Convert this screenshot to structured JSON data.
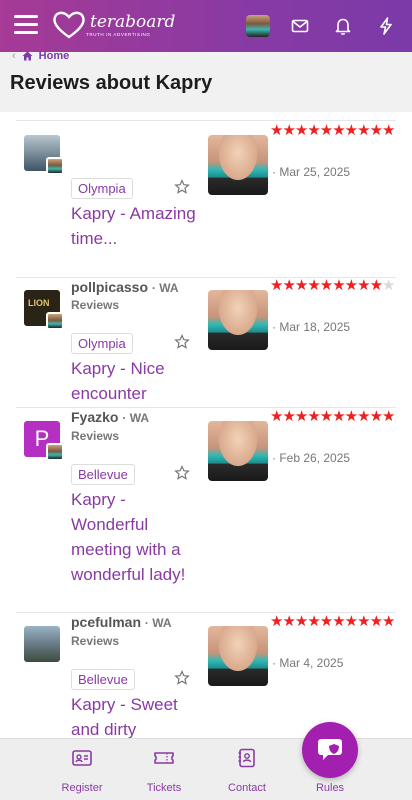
{
  "header": {
    "logo_text": "teraboard",
    "logo_tagline": "TRUTH IN ADVERTISING"
  },
  "breadcrumb": {
    "home_label": "Home"
  },
  "page_title": "Reviews about Kapry",
  "reviews": [
    {
      "username": "",
      "region": "",
      "reviews_label": "",
      "location": "Olympia",
      "title": "Kapry - Amazing time...",
      "stars_filled": 10,
      "stars_total": 10,
      "date": "Mar 25, 2025"
    },
    {
      "username": "pollpicasso",
      "region": "WA",
      "reviews_label": "Reviews",
      "location": "Olympia",
      "title": "Kapry - Nice encounter",
      "stars_filled": 9,
      "stars_total": 10,
      "date": "Mar 18, 2025",
      "avatar_text": "LION"
    },
    {
      "username": "Fyazko",
      "region": "WA",
      "reviews_label": "Reviews",
      "location": "Bellevue",
      "title": "Kapry - Wonderful meeting with a wonderful lady!",
      "stars_filled": 10,
      "stars_total": 10,
      "date": "Feb 26, 2025",
      "avatar_letter": "P"
    },
    {
      "username": "pcefulman",
      "region": "WA",
      "reviews_label": "Reviews",
      "location": "Bellevue",
      "title": "Kapry - Sweet and dirty",
      "stars_filled": 10,
      "stars_total": 10,
      "date": "Mar 4, 2025"
    }
  ],
  "bottom_nav": {
    "register": "Register",
    "tickets": "Tickets",
    "contact": "Contact",
    "rules": "Rules"
  },
  "colors": {
    "accent": "#8a3aa3",
    "header_start": "#a63a96",
    "header_end": "#7b3aa8",
    "star": "#ee2020",
    "fab": "#a21fb0"
  }
}
